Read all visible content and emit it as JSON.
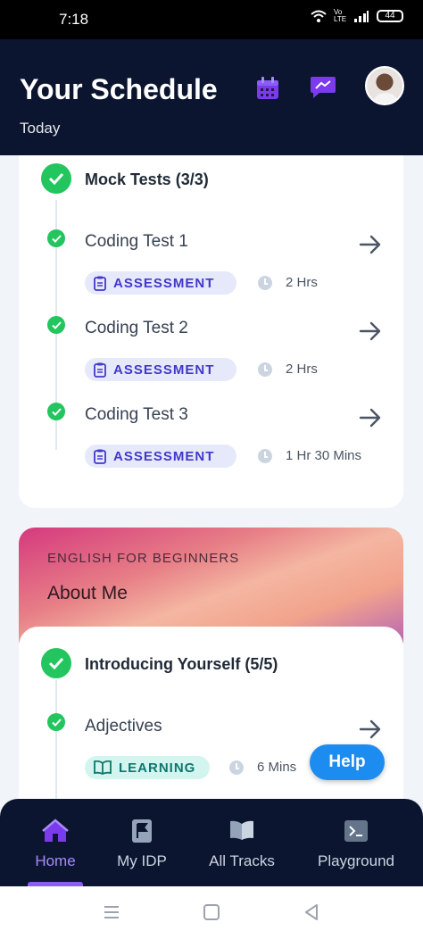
{
  "status": {
    "time": "7:18",
    "battery": "44",
    "volte": "Vo LTE"
  },
  "header": {
    "title": "Your Schedule",
    "subtitle": "Today"
  },
  "icons": {
    "calendar": "calendar-icon",
    "messages": "chat-icon",
    "arrow": "arrow-right-icon",
    "clipboard": "clipboard-icon",
    "book": "book-icon",
    "clock": "clock-icon"
  },
  "colors": {
    "accent": "#7c3aed",
    "success": "#22c55e",
    "header_bg": "#0b1530",
    "help": "#1d8cf0"
  },
  "mock_tests": {
    "title": "Mock Tests (3/3)",
    "items": [
      {
        "title": "Coding Test 1",
        "tag": "ASSESSMENT",
        "duration": "2 Hrs"
      },
      {
        "title": "Coding Test 2",
        "tag": "ASSESSMENT",
        "duration": "2 Hrs"
      },
      {
        "title": "Coding Test 3",
        "tag": "ASSESSMENT",
        "duration": "1 Hr 30 Mins"
      }
    ]
  },
  "course": {
    "kicker": "ENGLISH FOR BEGINNERS",
    "name": "About Me",
    "section_title": "Introducing Yourself (5/5)",
    "items": [
      {
        "title": "Adjectives",
        "tag": "LEARNING",
        "duration": "6 Mins"
      }
    ]
  },
  "help_label": "Help",
  "nav": [
    {
      "label": "Home",
      "active": true
    },
    {
      "label": "My IDP",
      "active": false
    },
    {
      "label": "All Tracks",
      "active": false
    },
    {
      "label": "Playground",
      "active": false
    }
  ]
}
